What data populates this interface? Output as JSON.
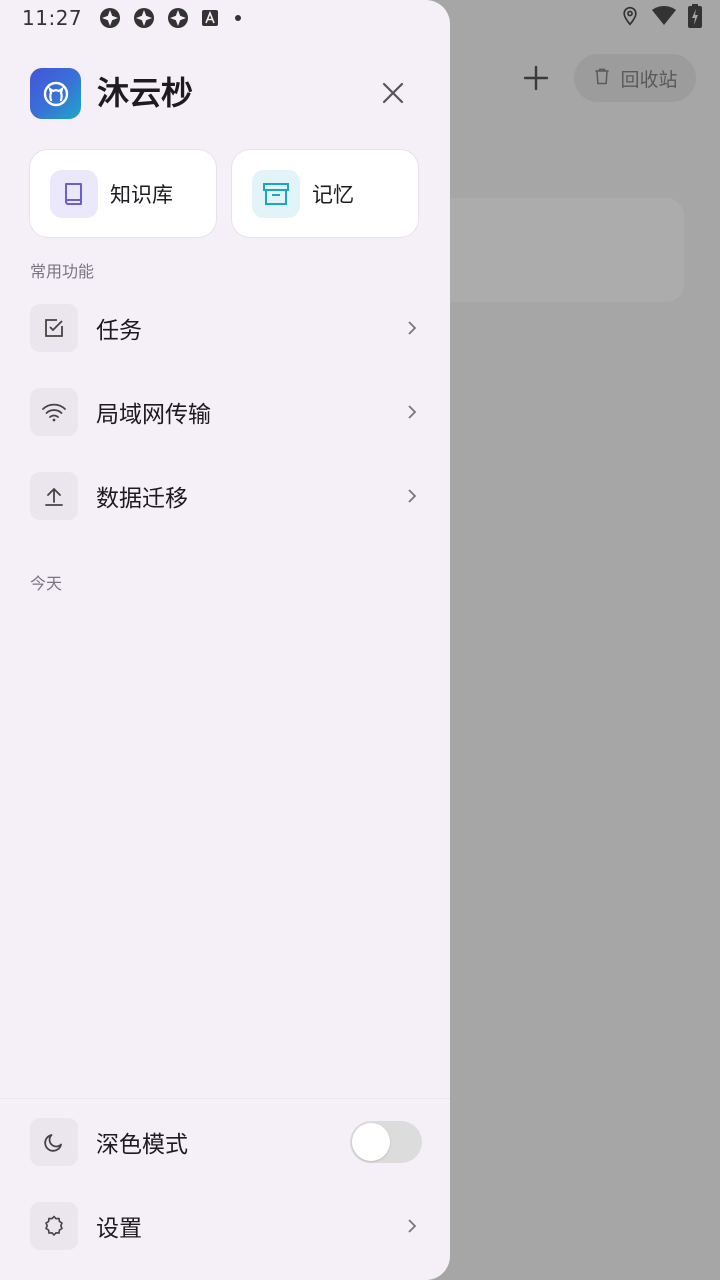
{
  "status_bar": {
    "time": "11:27"
  },
  "background": {
    "recycle_label": "回收站"
  },
  "drawer": {
    "app_name": "沐云杪",
    "quick_actions": [
      {
        "label": "知识库",
        "icon": "book-icon"
      },
      {
        "label": "记忆",
        "icon": "archive-icon"
      }
    ],
    "common_section_label": "常用功能",
    "menu": [
      {
        "label": "任务",
        "icon": "checkbox-icon"
      },
      {
        "label": "局域网传输",
        "icon": "wifi-icon"
      },
      {
        "label": "数据迁移",
        "icon": "upload-icon"
      }
    ],
    "today_label": "今天",
    "dark_mode_label": "深色模式",
    "dark_mode_on": false,
    "settings_label": "设置"
  },
  "colors": {
    "drawer_bg": "#f5f0f8",
    "logo_start": "#4355d9",
    "logo_end": "#1ea8c8",
    "book_icon": "#6a5fd0",
    "archive_icon": "#1aa6c4"
  }
}
